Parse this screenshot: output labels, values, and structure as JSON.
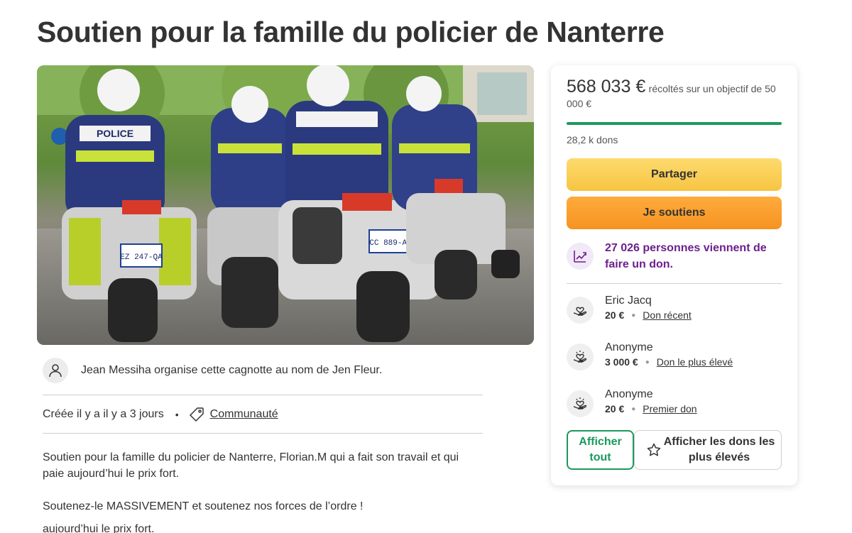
{
  "page": {
    "title": "Soutien pour la famille du policier de Nanterre"
  },
  "hero": {
    "plate_texts": [
      "EZ 247-QA",
      "CC 889-AR"
    ],
    "helmet_label": "POLICE"
  },
  "organizer": {
    "text": "Jean Messiha organise cette cagnotte au nom de Jen Fleur."
  },
  "meta": {
    "created": "Créée il y a il y a 3 jours",
    "separator": "•",
    "category": "Communauté"
  },
  "description": {
    "paragraph1": "Soutien pour la famille du policier de Nanterre, Florian.M qui a fait son travail et qui paie aujourd’hui le prix fort.",
    "paragraph2": "Soutenez-le MASSIVEMENT et soutenez nos forces de l’ordre !",
    "overflow_line": "aujourd’hui le prix fort."
  },
  "donation_card": {
    "amount": "568 033 €",
    "goal_text": "récoltés sur un objectif de 50 000 €",
    "progress_fraction": 1.0,
    "donation_count": "28,2 k dons",
    "share_label": "Partager",
    "donate_label": "Je soutiens",
    "trend_text": "27 026 personnes viennent de faire un don.",
    "donors": [
      {
        "name": "Eric Jacq",
        "amount": "20 €",
        "tag": "Don récent"
      },
      {
        "name": "Anonyme",
        "amount": "3 000 €",
        "tag": "Don le plus élevé"
      },
      {
        "name": "Anonyme",
        "amount": "20 €",
        "tag": "Premier don"
      }
    ],
    "show_all_label": "Afficher tout",
    "show_top_label": "Afficher les dons les plus élevés"
  },
  "colors": {
    "text": "#333333",
    "progress": "#1a9a5c",
    "share_button": "#f7c442",
    "donate_button": "#f59321",
    "trend_text": "#6c1f8e",
    "show_all_border": "#1a9a5c"
  },
  "icons": {
    "avatar": "person-icon",
    "category": "tag-icon",
    "trend": "trending-up-icon",
    "donor": "heart-hand-icon",
    "top_donations": "star-icon"
  }
}
